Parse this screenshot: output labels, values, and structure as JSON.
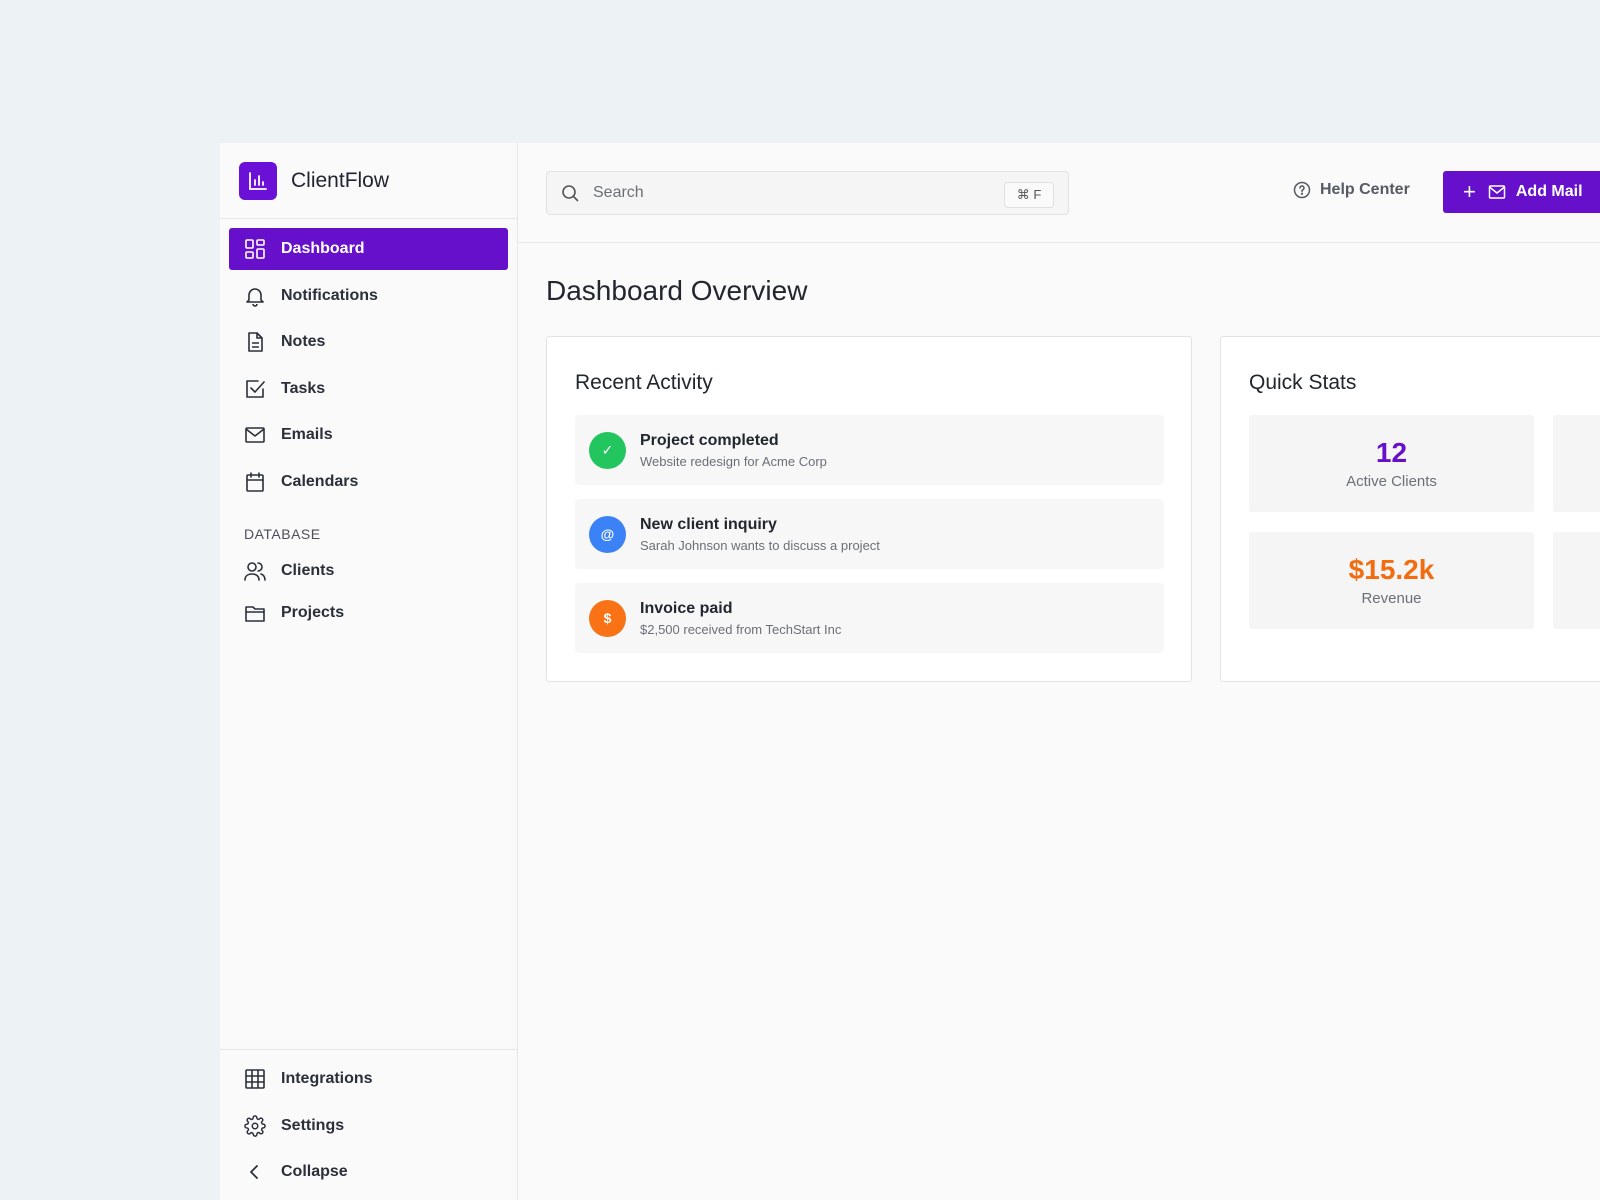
{
  "brand": {
    "name": "ClientFlow",
    "logo_icon": "bar-chart-icon",
    "accent": "#6610cc"
  },
  "sidebar": {
    "items": [
      {
        "label": "Dashboard",
        "icon": "grid-icon",
        "active": true
      },
      {
        "label": "Notifications",
        "icon": "bell-icon"
      },
      {
        "label": "Notes",
        "icon": "document-icon"
      },
      {
        "label": "Tasks",
        "icon": "checkbox-icon"
      },
      {
        "label": "Emails",
        "icon": "mail-icon"
      },
      {
        "label": "Calendars",
        "icon": "calendar-icon"
      }
    ],
    "section_label": "DATABASE",
    "db_items": [
      {
        "label": "Clients",
        "icon": "users-icon"
      },
      {
        "label": "Projects",
        "icon": "folder-icon"
      }
    ],
    "bottom_items": [
      {
        "label": "Integrations",
        "icon": "table-icon"
      },
      {
        "label": "Settings",
        "icon": "gear-icon"
      },
      {
        "label": "Collapse",
        "icon": "chevron-left-icon"
      }
    ]
  },
  "topbar": {
    "search_placeholder": "Search",
    "shortcut": "⌘ F",
    "help_label": "Help Center",
    "add_mail_label": "Add Mail"
  },
  "page_title": "Dashboard Overview",
  "recent_activity": {
    "title": "Recent Activity",
    "items": [
      {
        "title": "Project completed",
        "subtitle": "Website redesign for Acme Corp",
        "icon_glyph": "✓",
        "color": "#22c55e"
      },
      {
        "title": "New client inquiry",
        "subtitle": "Sarah Johnson wants to discuss a project",
        "icon_glyph": "@",
        "color": "#3b82f6"
      },
      {
        "title": "Invoice paid",
        "subtitle": "$2,500 received from TechStart Inc",
        "icon_glyph": "$",
        "color": "#f97316"
      }
    ]
  },
  "quick_stats": {
    "title": "Quick Stats",
    "stats": [
      {
        "value": "12",
        "label": "Active Clients",
        "color": "#6610cc"
      },
      {
        "value": "$15.2k",
        "label": "Revenue",
        "color": "#f26d0f"
      }
    ]
  }
}
